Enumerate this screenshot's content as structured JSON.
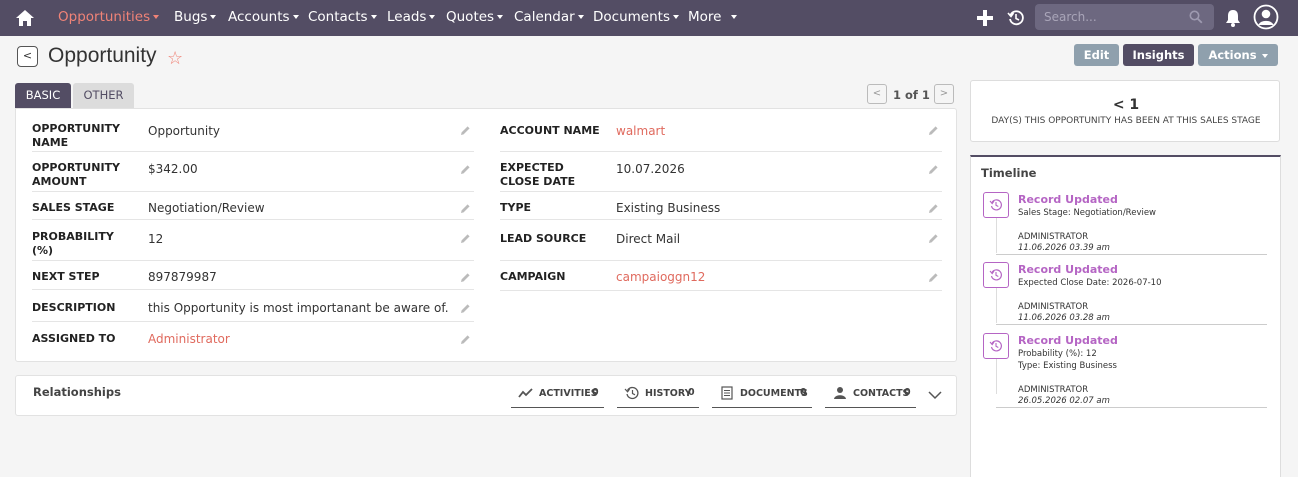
{
  "nav": {
    "items": [
      {
        "label": "Opportunities",
        "active": true
      },
      {
        "label": "Bugs"
      },
      {
        "label": "Accounts"
      },
      {
        "label": "Contacts"
      },
      {
        "label": "Leads"
      },
      {
        "label": "Quotes"
      },
      {
        "label": "Calendar"
      },
      {
        "label": "Documents"
      },
      {
        "label": "More"
      }
    ],
    "search_placeholder": "Search..."
  },
  "header": {
    "title": "Opportunity",
    "edit_label": "Edit",
    "insights_label": "Insights",
    "actions_label": "Actions"
  },
  "tabs": {
    "basic": "BASIC",
    "other": "OTHER"
  },
  "pager": {
    "count": "1 of 1",
    "prev": "<",
    "next": ">"
  },
  "back_label": "<",
  "fields": {
    "opportunity_name": {
      "label": "OPPORTUNITY NAME",
      "value": "Opportunity"
    },
    "opportunity_amount": {
      "label": "OPPORTUNITY AMOUNT",
      "value": "$342.00"
    },
    "sales_stage": {
      "label": "SALES STAGE",
      "value": "Negotiation/Review"
    },
    "probability": {
      "label": "PROBABILITY (%)",
      "value": "12"
    },
    "next_step": {
      "label": "NEXT STEP",
      "value": "897879987"
    },
    "description": {
      "label": "DESCRIPTION",
      "value": "this Opportunity is most importanant be aware of."
    },
    "assigned_to": {
      "label": "ASSIGNED TO",
      "value": "Administrator"
    },
    "account_name": {
      "label": "ACCOUNT NAME",
      "value": "walmart"
    },
    "expected_close_date": {
      "label": "EXPECTED CLOSE DATE",
      "value": "10.07.2026"
    },
    "type": {
      "label": "TYPE",
      "value": "Existing Business"
    },
    "lead_source": {
      "label": "LEAD SOURCE",
      "value": "Direct Mail"
    },
    "campaign": {
      "label": "CAMPAIGN",
      "value": "campaioggn12"
    }
  },
  "insight": {
    "value": "< 1",
    "label": "DAY(S) THIS OPPORTUNITY HAS BEEN AT THIS SALES STAGE"
  },
  "timeline": {
    "title": "Timeline",
    "entries": [
      {
        "title": "Record Updated",
        "lines": [
          "Sales Stage: Negotiation/Review"
        ],
        "user": "ADMINISTRATOR",
        "date": "11.06.2026 03.39 am"
      },
      {
        "title": "Record Updated",
        "lines": [
          "Expected Close Date: 2026-07-10"
        ],
        "user": "ADMINISTRATOR",
        "date": "11.06.2026 03.28 am"
      },
      {
        "title": "Record Updated",
        "lines": [
          "Probability (%): 12",
          "Type: Existing Business"
        ],
        "user": "ADMINISTRATOR",
        "date": "26.05.2026 02.07 am"
      }
    ]
  },
  "relationships": {
    "title": "Relationships",
    "tabs": [
      {
        "label": "ACTIVITIES",
        "count": "0",
        "icon": "activity-icon"
      },
      {
        "label": "HISTORY",
        "count": "0",
        "icon": "history-icon"
      },
      {
        "label": "DOCUMENTS",
        "count": "0",
        "icon": "document-icon"
      },
      {
        "label": "CONTACTS",
        "count": "0",
        "icon": "person-icon"
      }
    ]
  },
  "colors": {
    "nav_bg": "#534d64",
    "accent": "#f08377",
    "link": "#e06a5e",
    "timeline_accent": "#b565c4"
  }
}
